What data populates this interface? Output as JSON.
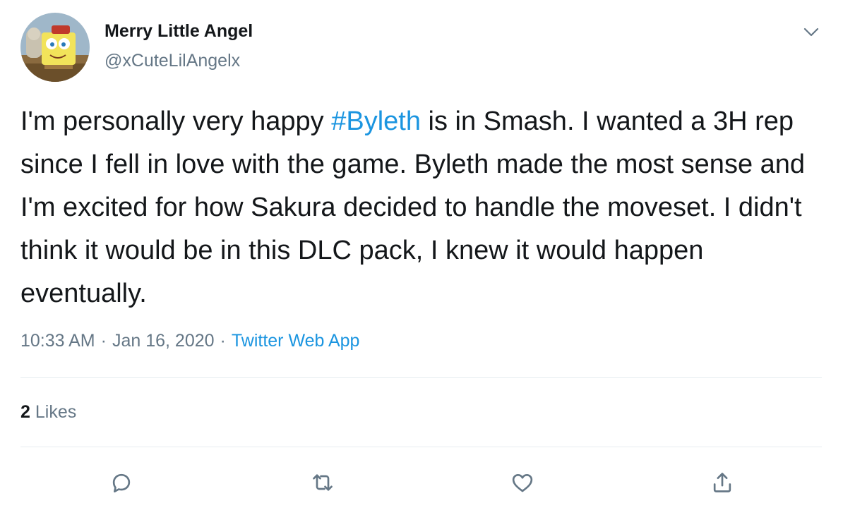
{
  "tweet": {
    "author": {
      "display_name": "Merry Little Angel",
      "handle": "@xCuteLilAngelx"
    },
    "text": {
      "before": "I'm personally very happy ",
      "hashtag": "#Byleth",
      "after": " is in Smash. I wanted a 3H rep since I fell in love with the game. Byleth made the most sense and I'm excited for how Sakura decided to handle the moveset. I didn't think it would be in this DLC pack, I knew it would happen eventually."
    },
    "meta": {
      "time": "10:33 AM",
      "separator": "·",
      "date": "Jan 16, 2020",
      "source": "Twitter Web App"
    },
    "likes": {
      "count": "2",
      "label": "Likes"
    },
    "actions": [
      {
        "name": "reply",
        "icon": "reply-icon"
      },
      {
        "name": "retweet",
        "icon": "retweet-icon"
      },
      {
        "name": "like",
        "icon": "heart-icon"
      },
      {
        "name": "share",
        "icon": "share-icon"
      }
    ],
    "colors": {
      "text": "#14171a",
      "secondary": "#657786",
      "link": "#1b95e0",
      "divider": "#e6ecf0"
    }
  }
}
